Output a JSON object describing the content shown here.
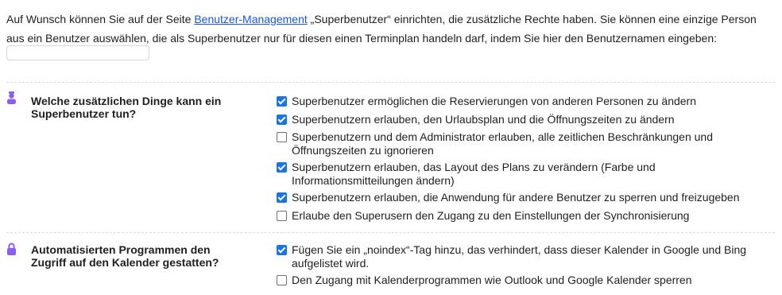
{
  "intro": {
    "before_link": "Auf Wunsch können Sie auf der Seite ",
    "link": "Benutzer-Management",
    "after_link": " „Superbenutzer“ einrichten, die zusätzliche Rechte haben. Sie können eine einzige Person aus ein Benutzer auswählen, die als Superbenutzer nur für diesen einen Terminplan handeln darf, indem Sie hier den Benutzernamen eingeben:"
  },
  "username_input": {
    "value": "",
    "placeholder": ""
  },
  "accent_color": "#1a73e8",
  "icon_color": "#8b5cf6",
  "sections": [
    {
      "icon": "superuser-icon",
      "title": "Welche zusätzlichen Dinge kann ein Superbenutzer tun?",
      "options": [
        {
          "label": "Superbenutzer ermöglichen die Reservierungen von anderen Personen zu ändern",
          "checked": true
        },
        {
          "label": "Superbenutzern erlauben, den Urlaubsplan und die Öffnungszeiten zu ändern",
          "checked": true
        },
        {
          "label": "Superbenutzern und dem Administrator erlauben, alle zeitlichen Beschränkungen und Öffnungszeiten zu ignorieren",
          "checked": false
        },
        {
          "label": "Superbenutzern erlauben, das Layout des Plans zu verändern (Farbe und Informationsmitteilungen ändern)",
          "checked": true
        },
        {
          "label": "Superbenutzern erlauben, die Anwendung für andere Benutzer zu sperren und freizugeben",
          "checked": true
        },
        {
          "label": "Erlaube den Superusern den Zugang zu den Einstellungen der Synchronisierung",
          "checked": false
        }
      ]
    },
    {
      "icon": "lock-icon",
      "title": "Automatisierten Programmen den Zugriff auf den Kalender gestatten?",
      "options": [
        {
          "label": "Fügen Sie ein „noindex“-Tag hinzu, das verhindert, dass dieser Kalender in Google und Bing aufgelistet wird.",
          "checked": true
        },
        {
          "label": "Den Zugang mit Kalenderprogrammen wie Outlook und Google Kalender sperren",
          "checked": false
        }
      ]
    }
  ]
}
